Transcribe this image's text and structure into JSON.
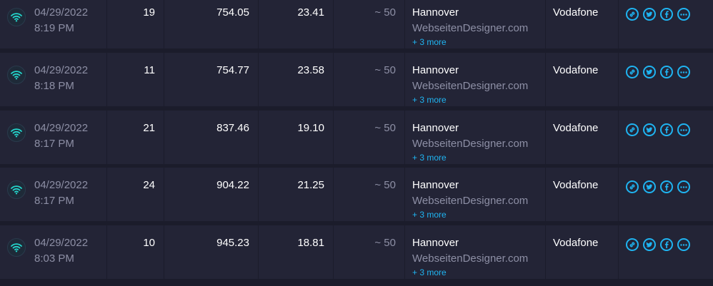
{
  "colors": {
    "background": "#1b1c2b",
    "row": "#232436",
    "accent": "#1fb4f1",
    "wifi": "#24d6cc",
    "muted": "#8d8fa5"
  },
  "icons": {
    "connection": "wifi-icon",
    "share": [
      "link-icon",
      "twitter-icon",
      "facebook-icon",
      "more-icon"
    ]
  },
  "results": [
    {
      "date": "04/29/2022",
      "time": "8:19 PM",
      "ping": "19",
      "download": "754.05",
      "upload": "23.41",
      "distance": "~ 50",
      "server": "Hannover",
      "sponsor": "WebseitenDesigner.com",
      "more": "+ 3 more",
      "isp": "Vodafone"
    },
    {
      "date": "04/29/2022",
      "time": "8:18 PM",
      "ping": "11",
      "download": "754.77",
      "upload": "23.58",
      "distance": "~ 50",
      "server": "Hannover",
      "sponsor": "WebseitenDesigner.com",
      "more": "+ 3 more",
      "isp": "Vodafone"
    },
    {
      "date": "04/29/2022",
      "time": "8:17 PM",
      "ping": "21",
      "download": "837.46",
      "upload": "19.10",
      "distance": "~ 50",
      "server": "Hannover",
      "sponsor": "WebseitenDesigner.com",
      "more": "+ 3 more",
      "isp": "Vodafone"
    },
    {
      "date": "04/29/2022",
      "time": "8:17 PM",
      "ping": "24",
      "download": "904.22",
      "upload": "21.25",
      "distance": "~ 50",
      "server": "Hannover",
      "sponsor": "WebseitenDesigner.com",
      "more": "+ 3 more",
      "isp": "Vodafone"
    },
    {
      "date": "04/29/2022",
      "time": "8:03 PM",
      "ping": "10",
      "download": "945.23",
      "upload": "18.81",
      "distance": "~ 50",
      "server": "Hannover",
      "sponsor": "WebseitenDesigner.com",
      "more": "+ 3 more",
      "isp": "Vodafone"
    }
  ]
}
